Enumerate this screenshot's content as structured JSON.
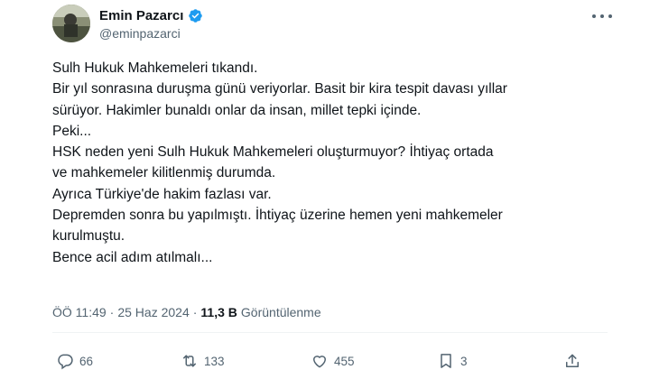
{
  "author": {
    "name": "Emin Pazarcı",
    "handle": "@eminpazarci",
    "verified": true,
    "verified_color": "#1d9bf0"
  },
  "post": {
    "lines": [
      "Sulh Hukuk Mahkemeleri tıkandı.",
      "Bir yıl sonrasına duruşma günü veriyorlar. Basit bir kira tespit davası yıllar",
      "sürüyor. Hakimler bunaldı onlar da insan, millet tepki içinde.",
      "Peki...",
      "HSK neden yeni Sulh Hukuk Mahkemeleri oluşturmuyor? İhtiyaç ortada",
      "ve mahkemeler kilitlenmiş durumda.",
      "Ayrıca Türkiye'de hakim fazlası var.",
      "Depremden sonra bu yapılmıştı. İhtiyaç üzerine hemen yeni mahkemeler",
      "kurulmuştu.",
      "Bence acil adım atılmalı..."
    ]
  },
  "meta": {
    "time": "ÖÖ 11:49",
    "separator": "·",
    "date": "25 Haz 2024",
    "views_count": "11,3 B",
    "views_label": "Görüntülenme"
  },
  "actions": {
    "replies": "66",
    "reposts": "133",
    "likes": "455",
    "bookmarks": "3"
  },
  "icons": [
    "more-icon",
    "verified-icon",
    "reply-icon",
    "repost-icon",
    "like-icon",
    "bookmark-icon",
    "share-icon"
  ],
  "colors": {
    "text": "#0f1419",
    "secondary": "#536471",
    "divider": "#eff3f4"
  }
}
